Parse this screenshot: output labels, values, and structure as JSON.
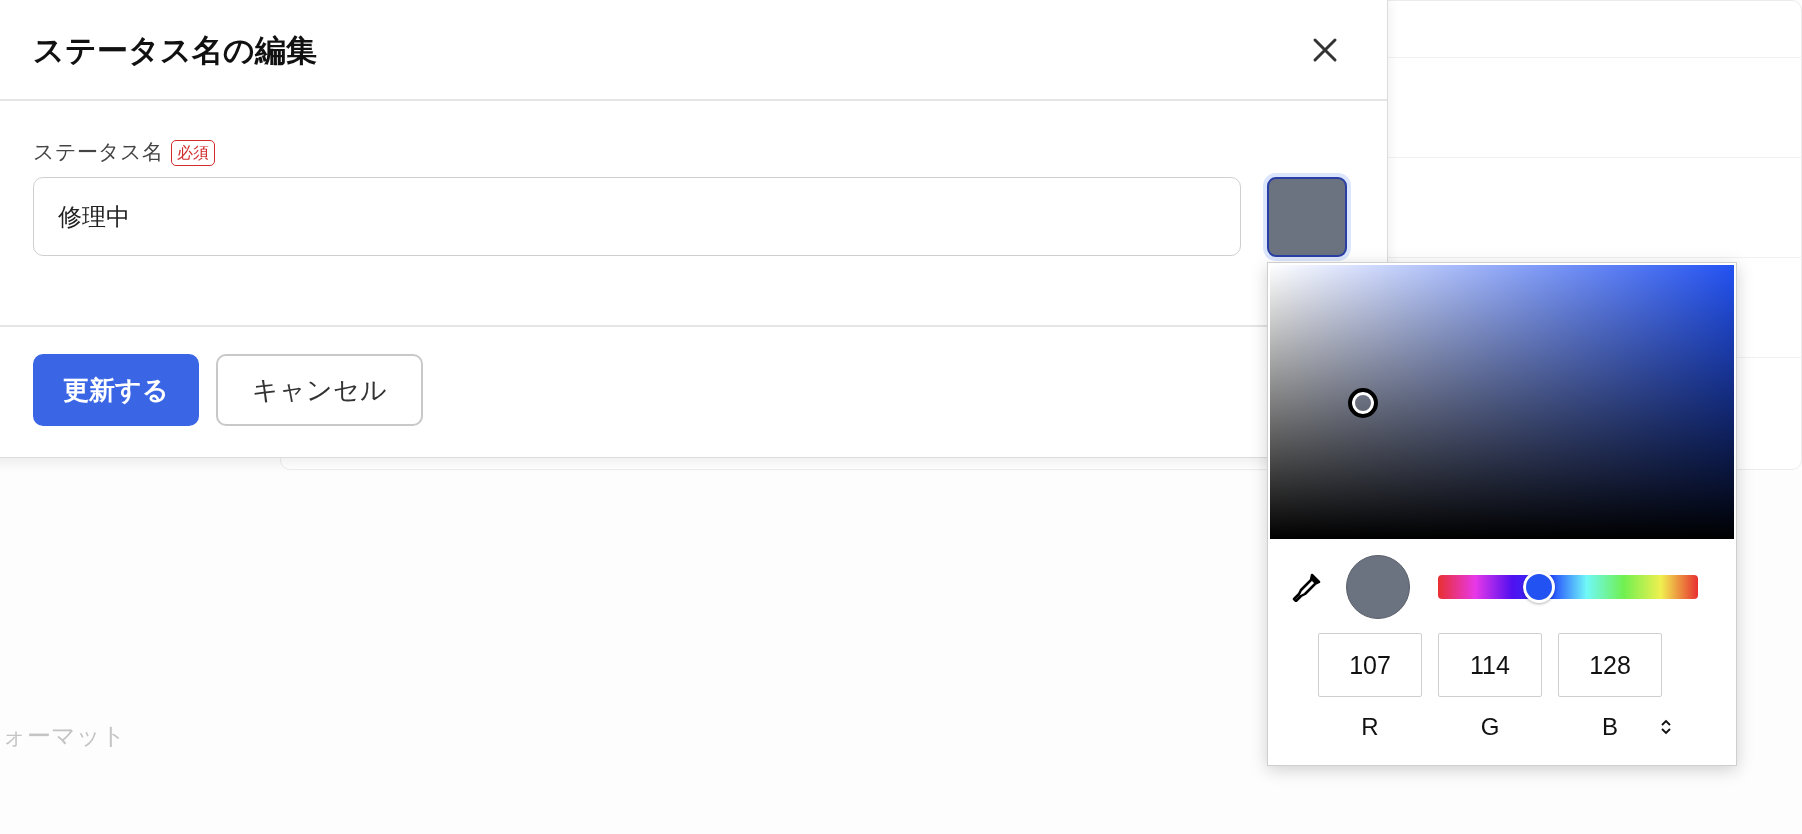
{
  "background": {
    "format_label": "ォーマット"
  },
  "dialog": {
    "title": "ステータス名の編集",
    "field": {
      "label": "ステータス名",
      "required_badge": "必須",
      "value": "修理中",
      "color": "#6b7280"
    },
    "buttons": [
      {
        "label": "更新する",
        "kind": "primary"
      },
      {
        "label": "キャンセル",
        "kind": "secondary"
      }
    ]
  },
  "color_picker": {
    "hue": {
      "level": 0.39
    },
    "channels": [
      {
        "label": "R",
        "value": "107"
      },
      {
        "label": "G",
        "value": "114"
      },
      {
        "label": "B",
        "value": "128"
      }
    ]
  }
}
